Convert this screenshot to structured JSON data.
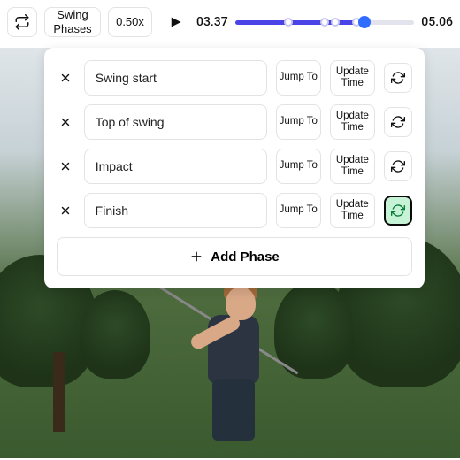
{
  "toolbar": {
    "phases_label": "Swing Phases",
    "speed_label": "0.50x"
  },
  "timeline": {
    "current": "03.37",
    "duration": "05.06",
    "fill_pct": 72,
    "markers_pct": [
      30,
      50,
      56,
      68
    ],
    "playhead_pct": 72
  },
  "panel": {
    "jump_label": "Jump To",
    "update_label": "Update Time",
    "add_label": "Add Phase",
    "phases": [
      {
        "name": "Swing start",
        "active": false
      },
      {
        "name": "Top of swing",
        "active": false
      },
      {
        "name": "Impact",
        "active": false
      },
      {
        "name": "Finish",
        "active": true
      }
    ]
  }
}
